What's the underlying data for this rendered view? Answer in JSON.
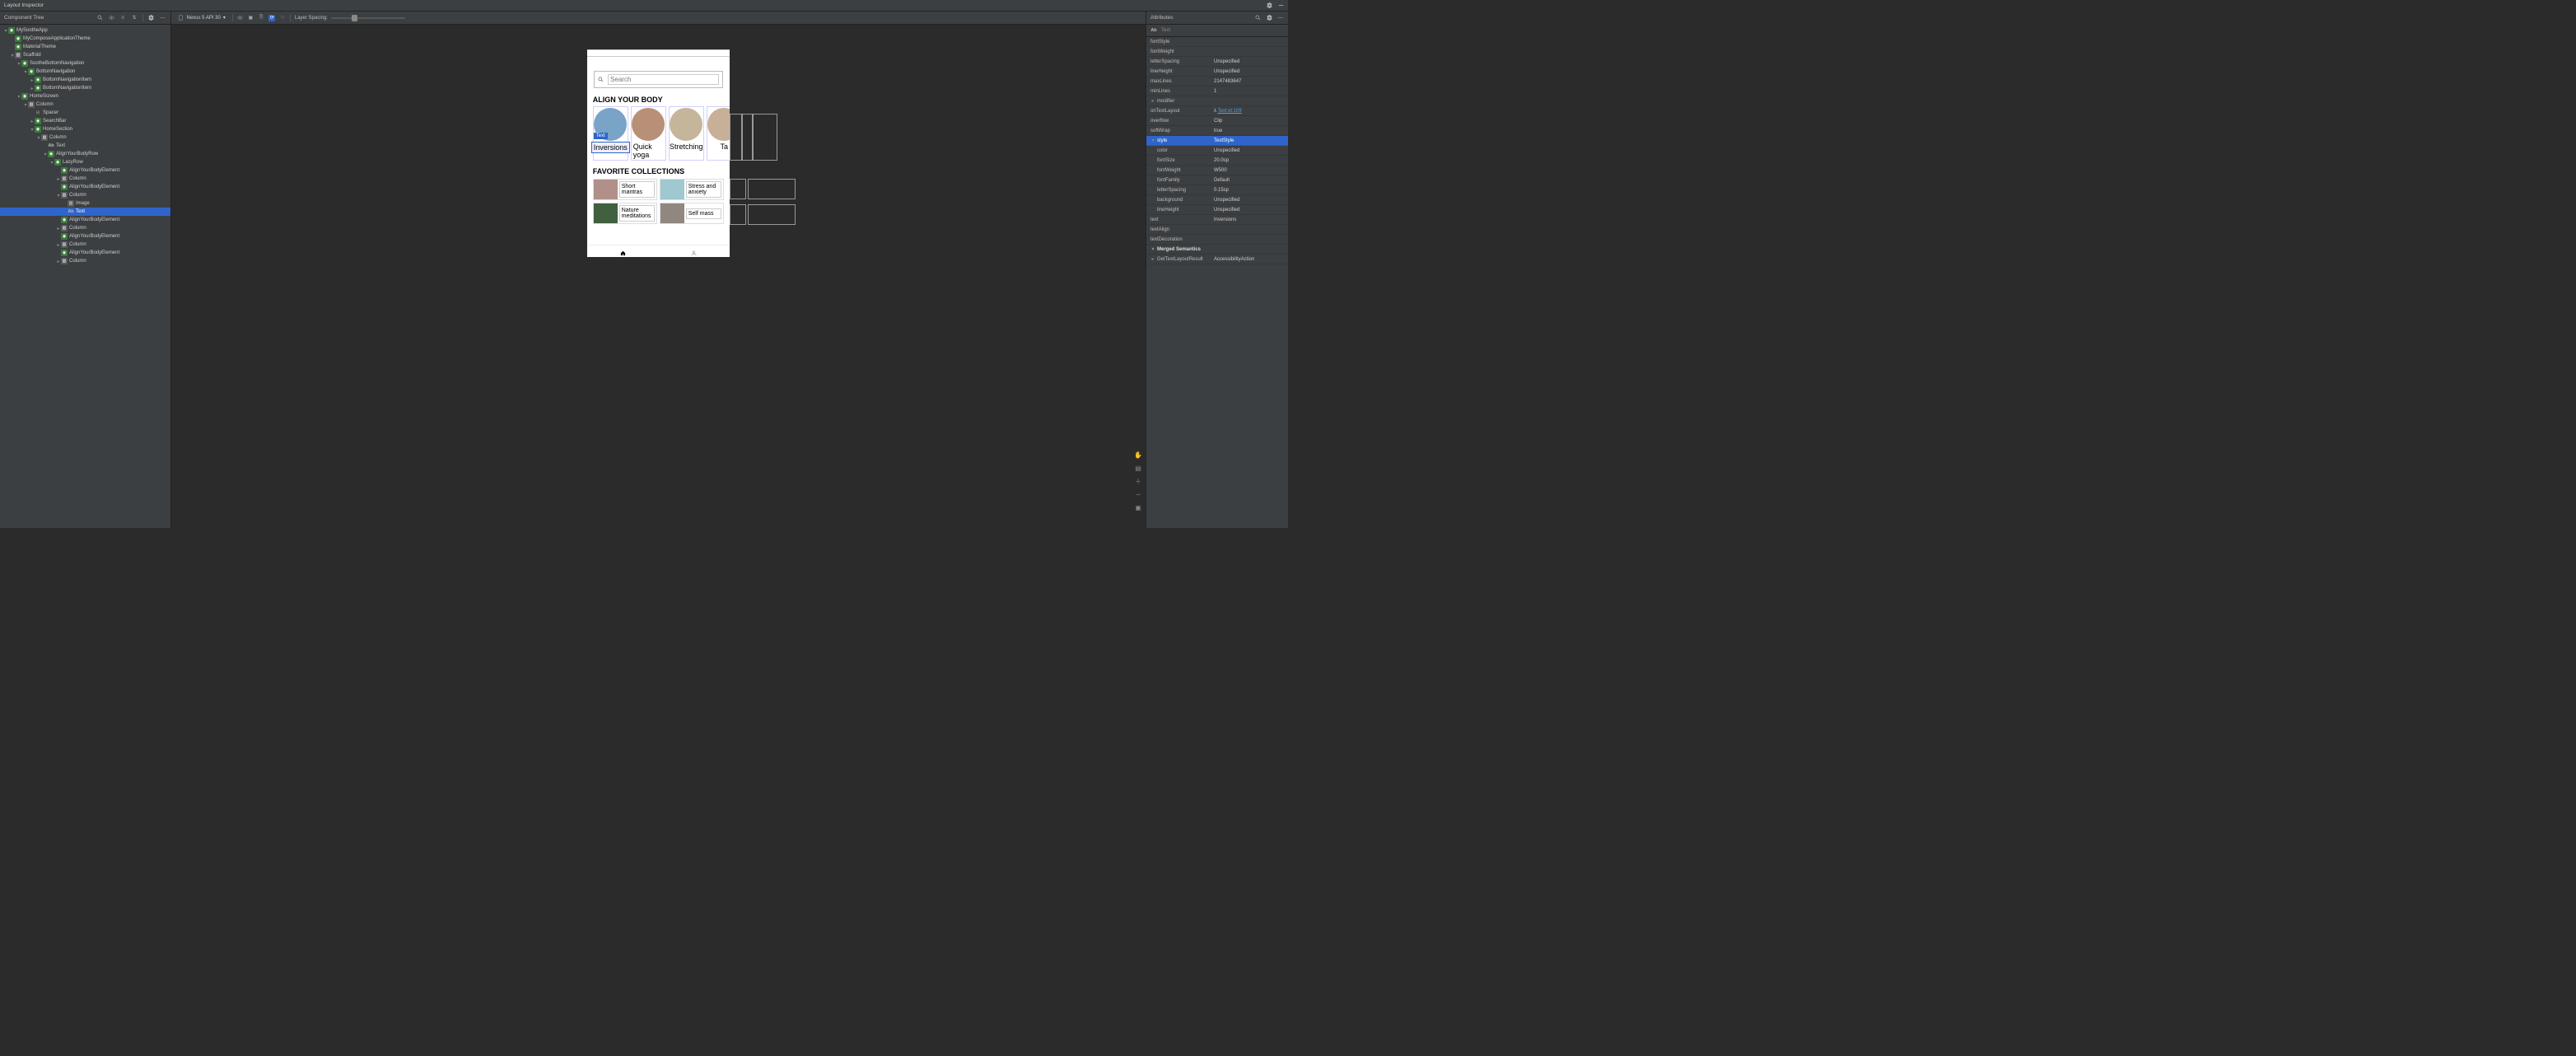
{
  "title": "Layout Inspector",
  "panels": {
    "tree": "Component Tree",
    "attrs": "Attributes"
  },
  "toolbar": {
    "device": "Nexus 5 API 30",
    "layer_spacing": "Layer Spacing:"
  },
  "tree": [
    {
      "d": 0,
      "ar": "▾",
      "ic": "comp",
      "lbl": "MySootheApp"
    },
    {
      "d": 1,
      "ar": "",
      "ic": "comp",
      "lbl": "MyComposeApplicationTheme"
    },
    {
      "d": 1,
      "ar": "",
      "ic": "comp",
      "lbl": "MaterialTheme"
    },
    {
      "d": 1,
      "ar": "▾",
      "ic": "col",
      "lbl": "Scaffold"
    },
    {
      "d": 2,
      "ar": "▾",
      "ic": "comp",
      "lbl": "SootheBottomNavigation"
    },
    {
      "d": 3,
      "ar": "▾",
      "ic": "comp",
      "lbl": "BottomNavigation"
    },
    {
      "d": 4,
      "ar": "▸",
      "ic": "comp",
      "lbl": "BottomNavigationItem"
    },
    {
      "d": 4,
      "ar": "▸",
      "ic": "comp",
      "lbl": "BottomNavigationItem"
    },
    {
      "d": 2,
      "ar": "▾",
      "ic": "comp",
      "lbl": "HomeScreen"
    },
    {
      "d": 3,
      "ar": "▾",
      "ic": "col",
      "lbl": "Column"
    },
    {
      "d": 4,
      "ar": "",
      "ic": "sp",
      "lbl": "Spacer"
    },
    {
      "d": 4,
      "ar": "▸",
      "ic": "comp",
      "lbl": "SearchBar"
    },
    {
      "d": 4,
      "ar": "▾",
      "ic": "comp",
      "lbl": "HomeSection"
    },
    {
      "d": 5,
      "ar": "▾",
      "ic": "col",
      "lbl": "Column"
    },
    {
      "d": 6,
      "ar": "",
      "ic": "ab",
      "lbl": "Text"
    },
    {
      "d": 6,
      "ar": "▾",
      "ic": "comp",
      "lbl": "AlignYourBodyRow"
    },
    {
      "d": 7,
      "ar": "▾",
      "ic": "comp",
      "lbl": "LazyRow"
    },
    {
      "d": 8,
      "ar": "",
      "ic": "comp",
      "lbl": "AlignYourBodyElement"
    },
    {
      "d": 8,
      "ar": "▸",
      "ic": "col",
      "lbl": "Column"
    },
    {
      "d": 8,
      "ar": "",
      "ic": "comp",
      "lbl": "AlignYourBodyElement"
    },
    {
      "d": 8,
      "ar": "▾",
      "ic": "col",
      "lbl": "Column"
    },
    {
      "d": 9,
      "ar": "",
      "ic": "img",
      "lbl": "Image"
    },
    {
      "d": 9,
      "ar": "",
      "ic": "ab",
      "lbl": "Text",
      "sel": true
    },
    {
      "d": 8,
      "ar": "",
      "ic": "comp",
      "lbl": "AlignYourBodyElement"
    },
    {
      "d": 8,
      "ar": "▸",
      "ic": "col",
      "lbl": "Column"
    },
    {
      "d": 8,
      "ar": "",
      "ic": "comp",
      "lbl": "AlignYourBodyElement"
    },
    {
      "d": 8,
      "ar": "▸",
      "ic": "col",
      "lbl": "Column"
    },
    {
      "d": 8,
      "ar": "",
      "ic": "comp",
      "lbl": "AlignYourBodyElement"
    },
    {
      "d": 8,
      "ar": "▸",
      "ic": "col",
      "lbl": "Column"
    }
  ],
  "preview": {
    "search_ph": "Search",
    "h1": "ALIGN YOUR BODY",
    "badge": "Text",
    "ayb": [
      "Inversions",
      "Quick yoga",
      "Stretching",
      "Ta"
    ],
    "h2": "FAVORITE COLLECTIONS",
    "fav": [
      "Short mantras",
      "Stress and anxiety",
      "Nature meditations",
      "Self mass"
    ]
  },
  "attr_header": {
    "icon": "Ab",
    "label": "Text"
  },
  "attrs": [
    {
      "k": "fontStyle",
      "v": ""
    },
    {
      "k": "fontWeight",
      "v": ""
    },
    {
      "k": "letterSpacing",
      "v": "Unspecified"
    },
    {
      "k": "lineHeight",
      "v": "Unspecified"
    },
    {
      "k": "maxLines",
      "v": "2147483647"
    },
    {
      "k": "minLines",
      "v": "1"
    },
    {
      "k": "modifier",
      "v": "",
      "exp": "▸"
    },
    {
      "k": "onTextLayout",
      "v": "λ ",
      "link": "Text.kt:109"
    },
    {
      "k": "overflow",
      "v": "Clip"
    },
    {
      "k": "softWrap",
      "v": "true"
    },
    {
      "k": "style",
      "v": "TextStyle",
      "hl": true,
      "exp": "▾"
    },
    {
      "k": "color",
      "v": "Unspecified",
      "sub": true
    },
    {
      "k": "fontSize",
      "v": "20.0sp",
      "sub": true
    },
    {
      "k": "fontWeight",
      "v": "W500",
      "sub": true
    },
    {
      "k": "fontFamily",
      "v": "Default",
      "sub": true
    },
    {
      "k": "letterSpacing",
      "v": "0.15sp",
      "sub": true
    },
    {
      "k": "background",
      "v": "Unspecified",
      "sub": true
    },
    {
      "k": "lineHeight",
      "v": "Unspecified",
      "sub": true
    },
    {
      "k": "text",
      "v": "Inversions"
    },
    {
      "k": "textAlign",
      "v": ""
    },
    {
      "k": "textDecoration",
      "v": ""
    },
    {
      "k": "Merged Semantics",
      "v": "",
      "group": true,
      "exp": "▾"
    },
    {
      "k": "GetTextLayoutResult",
      "v": "AccessibilityAction",
      "exp": "▸"
    }
  ]
}
